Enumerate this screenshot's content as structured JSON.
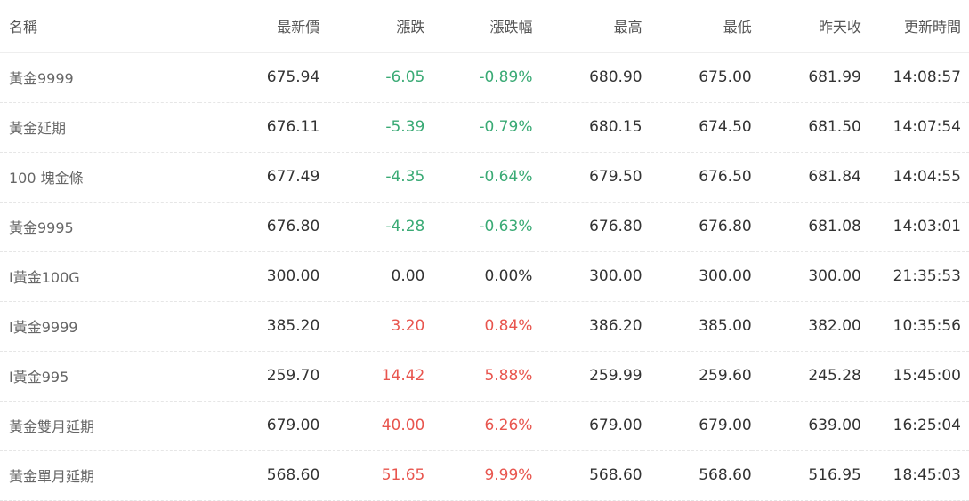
{
  "headers": [
    "名稱",
    "最新價",
    "漲跌",
    "漲跌幅",
    "最高",
    "最低",
    "昨天收",
    "更新時間"
  ],
  "rows": [
    {
      "name": "黃金9999",
      "last": "675.94",
      "change": "-6.05",
      "pct": "-0.89%",
      "high": "680.90",
      "low": "675.00",
      "prev": "681.99",
      "time": "14:08:57",
      "trend": "down"
    },
    {
      "name": "黃金延期",
      "last": "676.11",
      "change": "-5.39",
      "pct": "-0.79%",
      "high": "680.15",
      "low": "674.50",
      "prev": "681.50",
      "time": "14:07:54",
      "trend": "down"
    },
    {
      "name": "100 塊金條",
      "last": "677.49",
      "change": "-4.35",
      "pct": "-0.64%",
      "high": "679.50",
      "low": "676.50",
      "prev": "681.84",
      "time": "14:04:55",
      "trend": "down"
    },
    {
      "name": "黃金9995",
      "last": "676.80",
      "change": "-4.28",
      "pct": "-0.63%",
      "high": "676.80",
      "low": "676.80",
      "prev": "681.08",
      "time": "14:03:01",
      "trend": "down"
    },
    {
      "name": "I黃金100G",
      "last": "300.00",
      "change": "0.00",
      "pct": "0.00%",
      "high": "300.00",
      "low": "300.00",
      "prev": "300.00",
      "time": "21:35:53",
      "trend": "flat"
    },
    {
      "name": "I黃金9999",
      "last": "385.20",
      "change": "3.20",
      "pct": "0.84%",
      "high": "386.20",
      "low": "385.00",
      "prev": "382.00",
      "time": "10:35:56",
      "trend": "up"
    },
    {
      "name": "I黃金995",
      "last": "259.70",
      "change": "14.42",
      "pct": "5.88%",
      "high": "259.99",
      "low": "259.60",
      "prev": "245.28",
      "time": "15:45:00",
      "trend": "up"
    },
    {
      "name": "黃金雙月延期",
      "last": "679.00",
      "change": "40.00",
      "pct": "6.26%",
      "high": "679.00",
      "low": "679.00",
      "prev": "639.00",
      "time": "16:25:04",
      "trend": "up"
    },
    {
      "name": "黃金單月延期",
      "last": "568.60",
      "change": "51.65",
      "pct": "9.99%",
      "high": "568.60",
      "low": "568.60",
      "prev": "516.95",
      "time": "18:45:03",
      "trend": "up"
    }
  ],
  "colors": {
    "down": "#3aaa75",
    "up": "#e8554e",
    "flat": "#333333"
  }
}
